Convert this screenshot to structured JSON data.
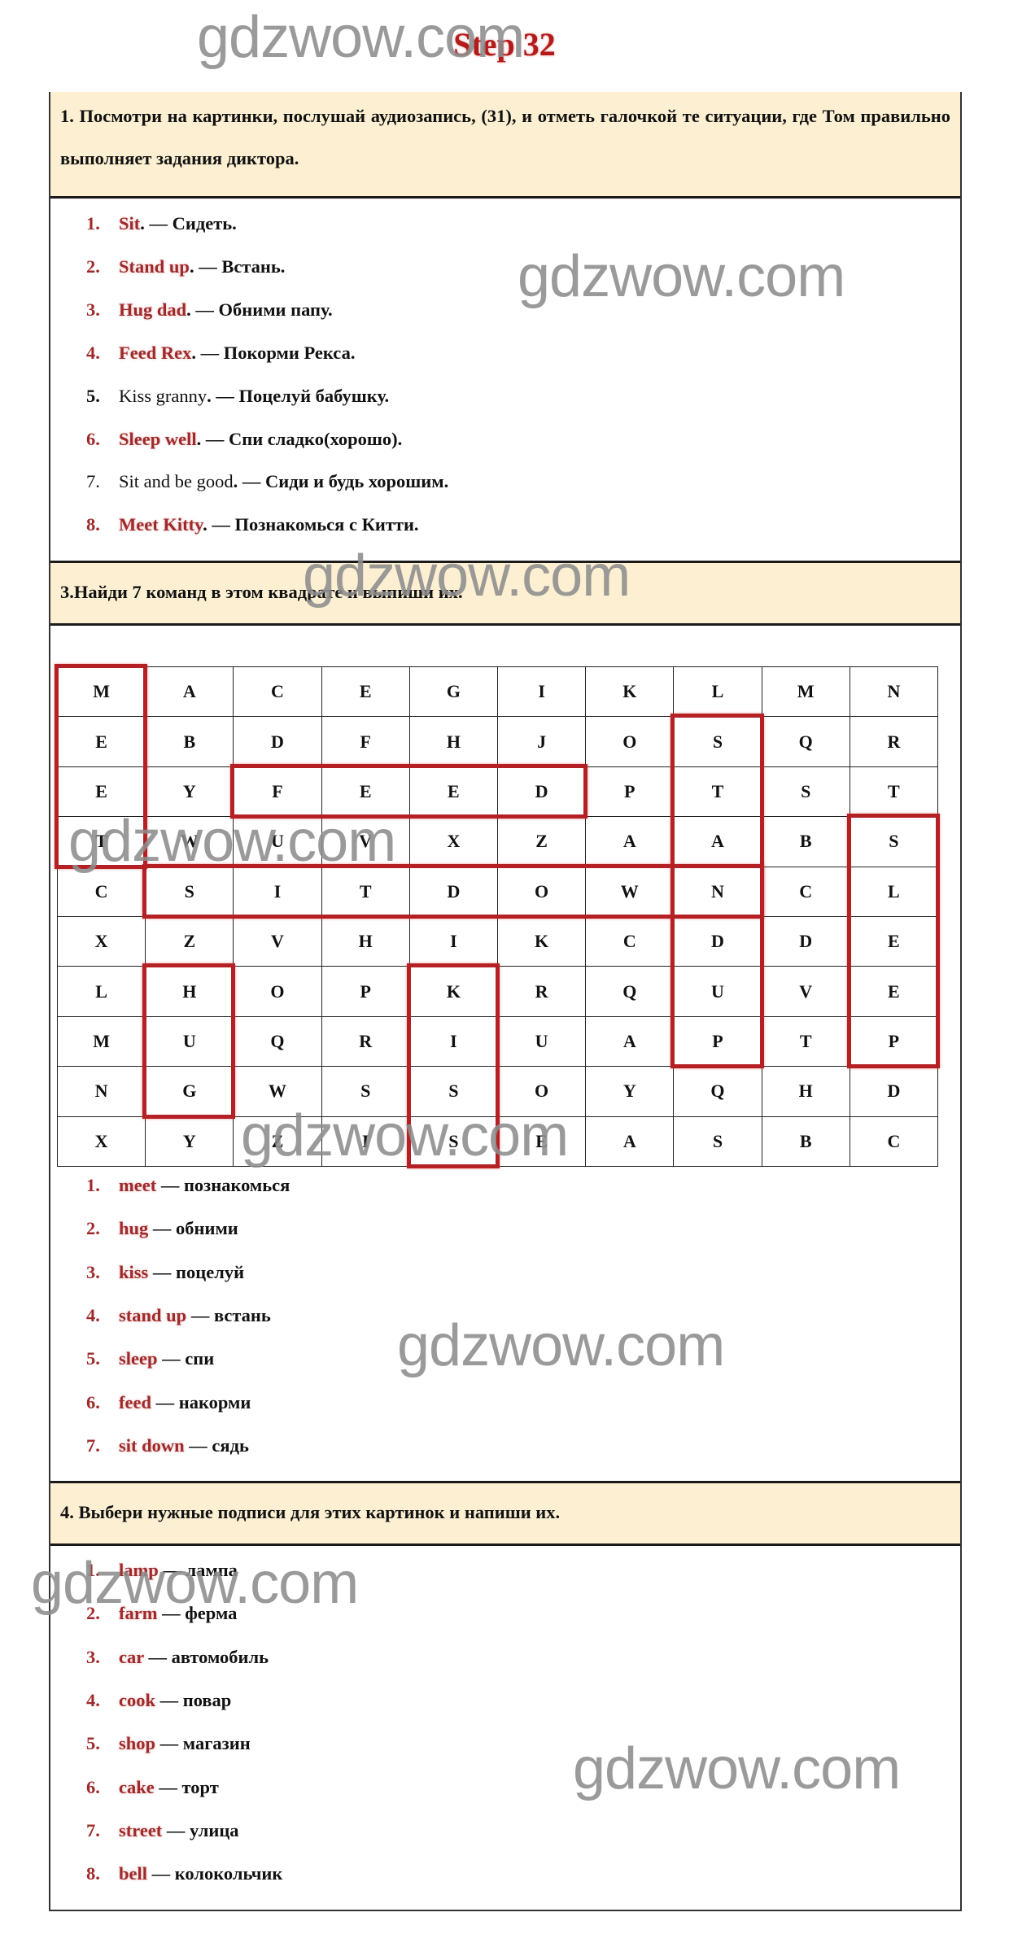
{
  "title": "Step 32",
  "watermark": "gdzwow.com",
  "colors": {
    "accent_red": "#9e2a2b",
    "box_red": "#b52025",
    "header_bg": "#fdf0d2"
  },
  "section1": {
    "header": "1. Посмотри на картинки, послушай аудиозапись, (31), и отметь галочкой те ситуации, где Том правильно выполняет задания диктора.",
    "items": [
      {
        "num": "1.",
        "en": "Sit",
        "ru": "Сидеть.",
        "marked": true
      },
      {
        "num": "2.",
        "en": "Stand up",
        "ru": "Встань.",
        "marked": true
      },
      {
        "num": "3.",
        "en": "Hug dad",
        "ru": "Обними папу.",
        "marked": true
      },
      {
        "num": "4.",
        "en": "Feed Rex",
        "ru": "Покорми Рекса.",
        "marked": true
      },
      {
        "num": "5.",
        "en": "Kiss granny",
        "ru": "Поцелуй бабушку.",
        "marked": false
      },
      {
        "num": "6.",
        "en": "Sleep well",
        "ru": "Спи сладко(хорошо).",
        "marked": true
      },
      {
        "num": "7.",
        "en": "Sit and be good",
        "ru": "Сиди и будь хорошим.",
        "marked": false
      },
      {
        "num": "8.",
        "en": "Meet Kitty",
        "ru": "Познакомься с Китти.",
        "marked": true
      }
    ]
  },
  "section3": {
    "header": "3.Найди 7 команд в этом квадрате и выпиши их.",
    "grid": [
      [
        "M",
        "A",
        "C",
        "E",
        "G",
        "I",
        "K",
        "L",
        "M",
        "N"
      ],
      [
        "E",
        "B",
        "D",
        "F",
        "H",
        "J",
        "O",
        "S",
        "Q",
        "R"
      ],
      [
        "E",
        "Y",
        "F",
        "E",
        "E",
        "D",
        "P",
        "T",
        "S",
        "T"
      ],
      [
        "T",
        "W",
        "U",
        "V",
        "X",
        "Z",
        "A",
        "A",
        "B",
        "S"
      ],
      [
        "C",
        "S",
        "I",
        "T",
        "D",
        "O",
        "W",
        "N",
        "C",
        "L"
      ],
      [
        "X",
        "Z",
        "V",
        "H",
        "I",
        "K",
        "C",
        "D",
        "D",
        "E"
      ],
      [
        "L",
        "H",
        "O",
        "P",
        "K",
        "R",
        "Q",
        "U",
        "V",
        "E"
      ],
      [
        "M",
        "U",
        "Q",
        "R",
        "I",
        "U",
        "A",
        "P",
        "T",
        "P"
      ],
      [
        "N",
        "G",
        "W",
        "S",
        "S",
        "O",
        "Y",
        "Q",
        "H",
        "D"
      ],
      [
        "X",
        "Y",
        "Z",
        "I",
        "S",
        "E",
        "A",
        "S",
        "B",
        "C"
      ]
    ],
    "found_words": [
      {
        "word": "MEET",
        "row": 0,
        "col": 0,
        "dir": "down",
        "len": 4
      },
      {
        "word": "FEED",
        "row": 2,
        "col": 2,
        "dir": "across",
        "len": 4
      },
      {
        "word": "SIT DOWN",
        "row": 4,
        "col": 1,
        "dir": "across",
        "len": 7
      },
      {
        "word": "STAND UP",
        "row": 1,
        "col": 7,
        "dir": "down",
        "len": 7
      },
      {
        "word": "SLEEP",
        "row": 3,
        "col": 9,
        "dir": "down",
        "len": 5
      },
      {
        "word": "HUG",
        "row": 6,
        "col": 1,
        "dir": "down",
        "len": 3
      },
      {
        "word": "KISS",
        "row": 6,
        "col": 4,
        "dir": "down",
        "len": 4
      }
    ],
    "items": [
      {
        "num": "1.",
        "en": "meet",
        "ru": "познакомься"
      },
      {
        "num": "2.",
        "en": "hug",
        "ru": "обними"
      },
      {
        "num": "3.",
        "en": "kiss",
        "ru": "поцелуй"
      },
      {
        "num": "4.",
        "en": "stand up",
        "ru": "встань"
      },
      {
        "num": "5.",
        "en": "sleep",
        "ru": "спи"
      },
      {
        "num": "6.",
        "en": "feed",
        "ru": "накорми"
      },
      {
        "num": "7.",
        "en": "sit down",
        "ru": "сядь"
      }
    ]
  },
  "section4": {
    "header": "4. Выбери нужные подписи для этих картинок и напиши их.",
    "items": [
      {
        "num": "1.",
        "en": "lamp",
        "ru": "лампа"
      },
      {
        "num": "2.",
        "en": "farm",
        "ru": "ферма"
      },
      {
        "num": "3.",
        "en": "car",
        "ru": "автомобиль"
      },
      {
        "num": "4.",
        "en": "cook",
        "ru": "повар"
      },
      {
        "num": "5.",
        "en": "shop",
        "ru": "магазин"
      },
      {
        "num": "6.",
        "en": "cake",
        "ru": "торт"
      },
      {
        "num": "7.",
        "en": "street",
        "ru": "улица"
      },
      {
        "num": "8.",
        "en": "bell",
        "ru": "колокольчик"
      }
    ]
  }
}
